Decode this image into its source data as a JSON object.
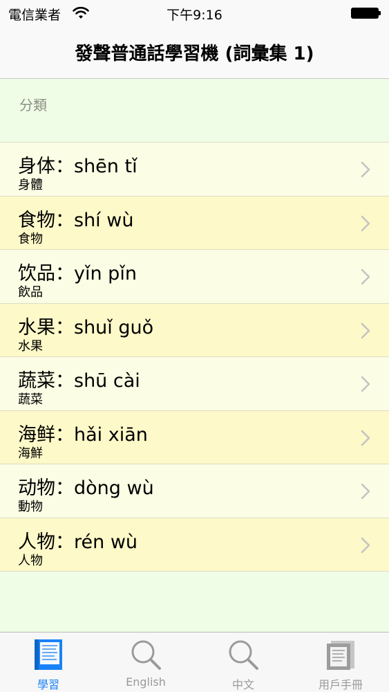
{
  "status_bar": {
    "carrier": "電信業者",
    "time": "下午9:16"
  },
  "nav": {
    "title": "發聲普通話學習機 (詞彙集 1)"
  },
  "section": {
    "header": "分類"
  },
  "items": [
    {
      "main": "身体：shēn  tǐ",
      "sub": "身體"
    },
    {
      "main": "食物：shí  wù",
      "sub": "食物"
    },
    {
      "main": "饮品：yǐn  pǐn",
      "sub": "飲品"
    },
    {
      "main": "水果：shuǐ  guǒ",
      "sub": "水果"
    },
    {
      "main": "蔬菜：shū  cài",
      "sub": "蔬菜"
    },
    {
      "main": "海鲜：hǎi  xiān",
      "sub": "海鮮"
    },
    {
      "main": "动物：dòng  wù",
      "sub": "動物"
    },
    {
      "main": "人物：rén  wù",
      "sub": "人物"
    }
  ],
  "tabs": [
    {
      "label": "學習",
      "icon": "book-icon",
      "active": true
    },
    {
      "label": "English",
      "icon": "search-icon",
      "active": false
    },
    {
      "label": "中文",
      "icon": "search-icon",
      "active": false
    },
    {
      "label": "用戶手冊",
      "icon": "manual-icon",
      "active": false
    }
  ],
  "colors": {
    "accent": "#1a82f7",
    "background": "#f0fde6",
    "row_a": "#fbfde4",
    "row_b": "#fdf9c8"
  }
}
